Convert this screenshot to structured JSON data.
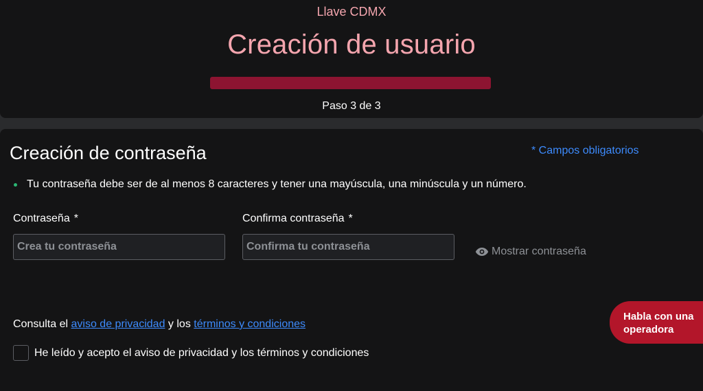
{
  "header": {
    "app_title": "Llave CDMX",
    "page_title": "Creación de usuario",
    "progress_fraction": 1.0,
    "step_label": "Paso 3 de 3"
  },
  "form": {
    "section_title": "Creación de contraseña",
    "required_note": "* Campos obligatorios",
    "rule_text": "Tu contraseña debe ser de al menos 8 caracteres y tener una mayúscula, una minúscula y un número.",
    "password": {
      "label": "Contraseña",
      "required_mark": "*",
      "placeholder": "Crea tu contraseña",
      "value": ""
    },
    "confirm": {
      "label": "Confirma contraseña",
      "required_mark": "*",
      "placeholder": "Confirma tu contraseña",
      "value": ""
    },
    "show_password_label": "Mostrar contraseña",
    "consult": {
      "prefix": "Consulta el ",
      "privacy_link": "aviso de privacidad",
      "middle": " y los ",
      "terms_link": "términos y condiciones"
    },
    "accept_label": "He leído y acepto el aviso de privacidad y los términos y condiciones",
    "accept_checked": false
  },
  "chat": {
    "line1": "Habla con una",
    "line2": "operadora"
  },
  "colors": {
    "accent_pink": "#f4a5ae",
    "progress_red": "#8d1431",
    "link_blue": "#3d8bfd",
    "chat_red": "#b3162a",
    "rule_dot_green": "#2bb673"
  },
  "icons": {
    "show_password": "eye-icon"
  }
}
